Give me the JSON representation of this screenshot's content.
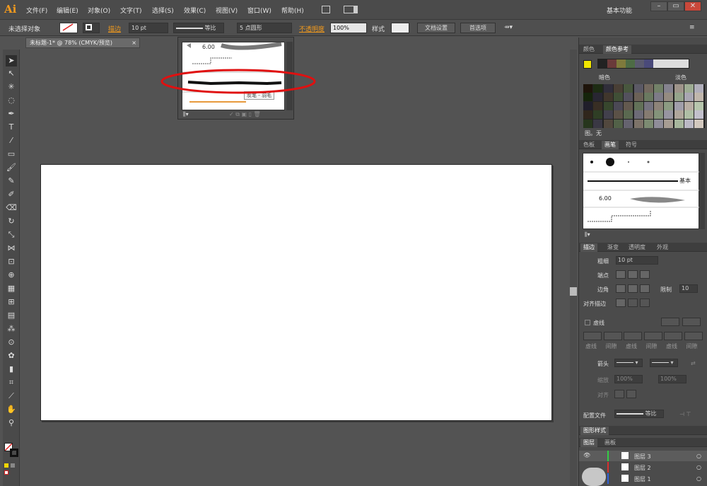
{
  "app": {
    "logo": "Ai",
    "workspace": "基本功能"
  },
  "menu": [
    "文件(F)",
    "编辑(E)",
    "对象(O)",
    "文字(T)",
    "选择(S)",
    "效果(C)",
    "视图(V)",
    "窗口(W)",
    "帮助(H)"
  ],
  "window": {
    "min": "–",
    "max": "▭",
    "close": "✕"
  },
  "control": {
    "no_selection": "未选择对象",
    "stroke_label": "描边",
    "stroke_weight": "10 pt",
    "profile": "等比",
    "brush": "5 点圆形",
    "opacity_label": "不透明度",
    "opacity": "100%",
    "style_label": "样式",
    "doc_setup": "文档设置",
    "prefs": "首选项"
  },
  "document": {
    "tab": "未标题-1* @ 78% (CMYK/预览)",
    "close": "×"
  },
  "brush_popup": {
    "top_value": "6.00",
    "tooltip": "炭笔 - 羽毛"
  },
  "color_guide": {
    "tabs": [
      "颜色",
      "颜色参考"
    ],
    "left_label": "暗色",
    "right_label": "淡色",
    "footer": "图。无",
    "colors": [
      "#222222",
      "#6a3a3a",
      "#7f7a3c",
      "#4d6b45",
      "#5a5a6e",
      "#4a4a7a"
    ]
  },
  "brushes": {
    "tabs": [
      "色板",
      "画笔",
      "符号"
    ],
    "basic_label": "基本",
    "width_value": "6.00"
  },
  "stroke": {
    "tabs": [
      "描边",
      "渐变",
      "透明度",
      "外观"
    ],
    "weight_label": "粗细",
    "weight": "10 pt",
    "cap_label": "端点",
    "corner_label": "边角",
    "limit_label": "限制",
    "limit": "10",
    "align_label": "对齐描边",
    "dashed_label": "虚线",
    "dash_labels": [
      "虚线",
      "间隙",
      "虚线",
      "间隙",
      "虚线",
      "间隙"
    ],
    "arrow_label": "箭头",
    "scale_label": "缩放",
    "scale_a": "100%",
    "scale_b": "100%",
    "align2_label": "对齐",
    "profile_label": "配置文件",
    "profile": "等比"
  },
  "graphic_styles": {
    "tab": "图形样式"
  },
  "layers": {
    "tabs": [
      "图层",
      "画板"
    ],
    "items": [
      "图层 3",
      "图层 2",
      "图层 1"
    ]
  }
}
